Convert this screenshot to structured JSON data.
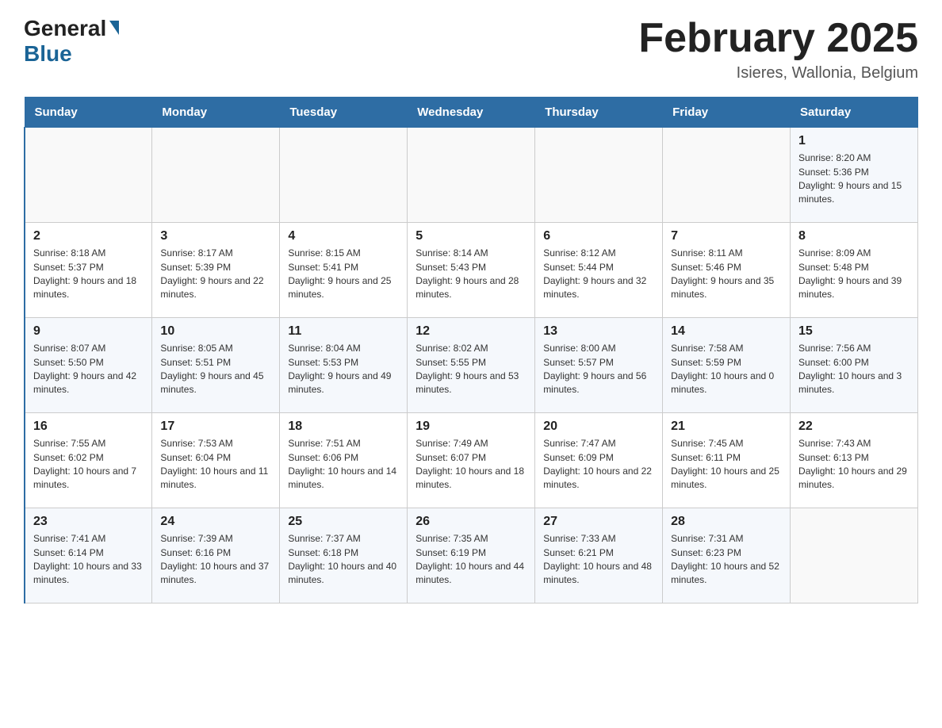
{
  "header": {
    "logo_general": "General",
    "logo_blue": "Blue",
    "month_title": "February 2025",
    "location": "Isieres, Wallonia, Belgium"
  },
  "days_of_week": [
    "Sunday",
    "Monday",
    "Tuesday",
    "Wednesday",
    "Thursday",
    "Friday",
    "Saturday"
  ],
  "weeks": [
    [
      {
        "day": "",
        "info": ""
      },
      {
        "day": "",
        "info": ""
      },
      {
        "day": "",
        "info": ""
      },
      {
        "day": "",
        "info": ""
      },
      {
        "day": "",
        "info": ""
      },
      {
        "day": "",
        "info": ""
      },
      {
        "day": "1",
        "info": "Sunrise: 8:20 AM\nSunset: 5:36 PM\nDaylight: 9 hours and 15 minutes."
      }
    ],
    [
      {
        "day": "2",
        "info": "Sunrise: 8:18 AM\nSunset: 5:37 PM\nDaylight: 9 hours and 18 minutes."
      },
      {
        "day": "3",
        "info": "Sunrise: 8:17 AM\nSunset: 5:39 PM\nDaylight: 9 hours and 22 minutes."
      },
      {
        "day": "4",
        "info": "Sunrise: 8:15 AM\nSunset: 5:41 PM\nDaylight: 9 hours and 25 minutes."
      },
      {
        "day": "5",
        "info": "Sunrise: 8:14 AM\nSunset: 5:43 PM\nDaylight: 9 hours and 28 minutes."
      },
      {
        "day": "6",
        "info": "Sunrise: 8:12 AM\nSunset: 5:44 PM\nDaylight: 9 hours and 32 minutes."
      },
      {
        "day": "7",
        "info": "Sunrise: 8:11 AM\nSunset: 5:46 PM\nDaylight: 9 hours and 35 minutes."
      },
      {
        "day": "8",
        "info": "Sunrise: 8:09 AM\nSunset: 5:48 PM\nDaylight: 9 hours and 39 minutes."
      }
    ],
    [
      {
        "day": "9",
        "info": "Sunrise: 8:07 AM\nSunset: 5:50 PM\nDaylight: 9 hours and 42 minutes."
      },
      {
        "day": "10",
        "info": "Sunrise: 8:05 AM\nSunset: 5:51 PM\nDaylight: 9 hours and 45 minutes."
      },
      {
        "day": "11",
        "info": "Sunrise: 8:04 AM\nSunset: 5:53 PM\nDaylight: 9 hours and 49 minutes."
      },
      {
        "day": "12",
        "info": "Sunrise: 8:02 AM\nSunset: 5:55 PM\nDaylight: 9 hours and 53 minutes."
      },
      {
        "day": "13",
        "info": "Sunrise: 8:00 AM\nSunset: 5:57 PM\nDaylight: 9 hours and 56 minutes."
      },
      {
        "day": "14",
        "info": "Sunrise: 7:58 AM\nSunset: 5:59 PM\nDaylight: 10 hours and 0 minutes."
      },
      {
        "day": "15",
        "info": "Sunrise: 7:56 AM\nSunset: 6:00 PM\nDaylight: 10 hours and 3 minutes."
      }
    ],
    [
      {
        "day": "16",
        "info": "Sunrise: 7:55 AM\nSunset: 6:02 PM\nDaylight: 10 hours and 7 minutes."
      },
      {
        "day": "17",
        "info": "Sunrise: 7:53 AM\nSunset: 6:04 PM\nDaylight: 10 hours and 11 minutes."
      },
      {
        "day": "18",
        "info": "Sunrise: 7:51 AM\nSunset: 6:06 PM\nDaylight: 10 hours and 14 minutes."
      },
      {
        "day": "19",
        "info": "Sunrise: 7:49 AM\nSunset: 6:07 PM\nDaylight: 10 hours and 18 minutes."
      },
      {
        "day": "20",
        "info": "Sunrise: 7:47 AM\nSunset: 6:09 PM\nDaylight: 10 hours and 22 minutes."
      },
      {
        "day": "21",
        "info": "Sunrise: 7:45 AM\nSunset: 6:11 PM\nDaylight: 10 hours and 25 minutes."
      },
      {
        "day": "22",
        "info": "Sunrise: 7:43 AM\nSunset: 6:13 PM\nDaylight: 10 hours and 29 minutes."
      }
    ],
    [
      {
        "day": "23",
        "info": "Sunrise: 7:41 AM\nSunset: 6:14 PM\nDaylight: 10 hours and 33 minutes."
      },
      {
        "day": "24",
        "info": "Sunrise: 7:39 AM\nSunset: 6:16 PM\nDaylight: 10 hours and 37 minutes."
      },
      {
        "day": "25",
        "info": "Sunrise: 7:37 AM\nSunset: 6:18 PM\nDaylight: 10 hours and 40 minutes."
      },
      {
        "day": "26",
        "info": "Sunrise: 7:35 AM\nSunset: 6:19 PM\nDaylight: 10 hours and 44 minutes."
      },
      {
        "day": "27",
        "info": "Sunrise: 7:33 AM\nSunset: 6:21 PM\nDaylight: 10 hours and 48 minutes."
      },
      {
        "day": "28",
        "info": "Sunrise: 7:31 AM\nSunset: 6:23 PM\nDaylight: 10 hours and 52 minutes."
      },
      {
        "day": "",
        "info": ""
      }
    ]
  ]
}
